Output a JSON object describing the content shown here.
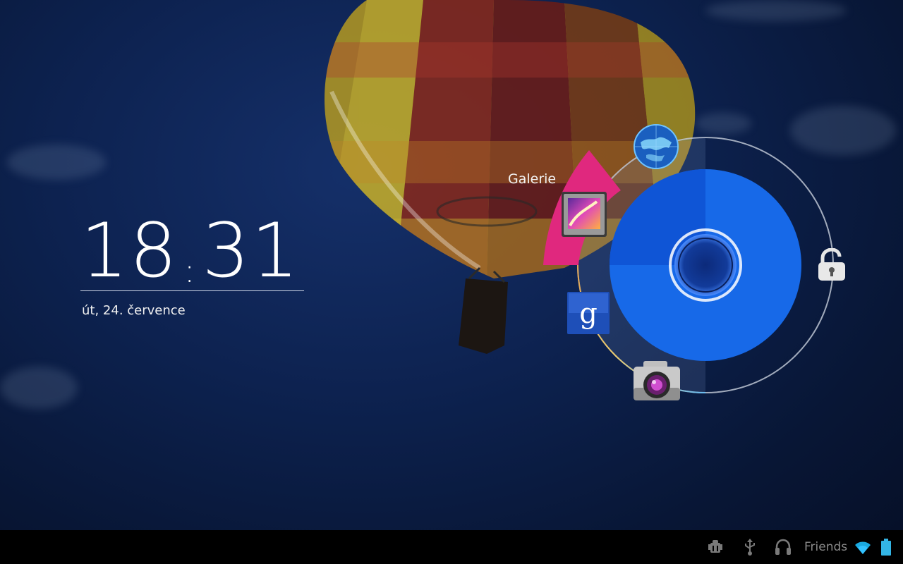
{
  "clock": {
    "hours": "18",
    "minutes": "31"
  },
  "date": "út, 24. července",
  "lock_targets": {
    "highlighted_label": "Galerie",
    "items": [
      {
        "name": "Galerie",
        "icon": "gallery-icon"
      },
      {
        "name": "Browser",
        "icon": "globe-icon"
      },
      {
        "name": "Google Search",
        "icon": "google-search-icon"
      },
      {
        "name": "Camera",
        "icon": "camera-icon"
      },
      {
        "name": "Unlock",
        "icon": "unlock-icon"
      }
    ]
  },
  "status_bar": {
    "friends_label": "Friends",
    "icons": [
      "android-debug-icon",
      "usb-icon",
      "headphones-icon",
      "wifi-icon",
      "battery-icon"
    ]
  },
  "colors": {
    "highlight_sector": "#e0287e",
    "handle_outer": "#0f55d6",
    "handle_inner": "#1a6cf0",
    "ring_stroke": "#c8d0dc"
  }
}
